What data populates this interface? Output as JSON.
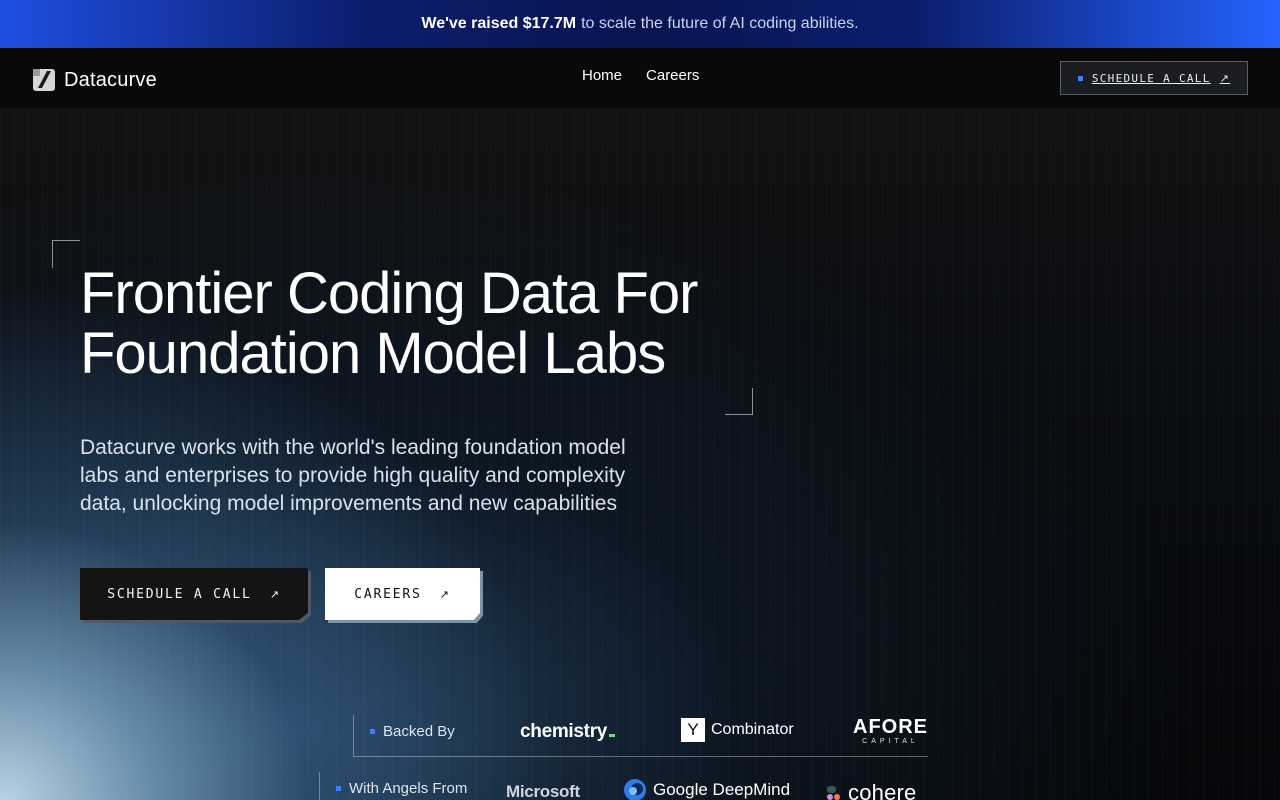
{
  "announcement": {
    "highlight": "We've raised $17.7M",
    "rest": "to scale the future of AI coding abilities."
  },
  "nav": {
    "brand": "Datacurve",
    "links": [
      "Home",
      "Careers"
    ],
    "cta": "SCHEDULE A CALL",
    "cta_arrow": "↗"
  },
  "hero": {
    "headline_line1": "Frontier Coding Data For",
    "headline_line2": "Foundation Model Labs",
    "subtext": "Datacurve works with the world's leading foundation model labs and enterprises to provide high quality and complexity data, unlocking model improvements and new capabilities",
    "primary_button": "SCHEDULE A CALL",
    "secondary_button": "CAREERS",
    "arrow": "↗"
  },
  "backers": {
    "label": "Backed By",
    "logos": {
      "chemistry": "chemistry",
      "yc_letter": "Y",
      "yc_text": "Combinator",
      "afore_main": "AFORE",
      "afore_sub": "CAPITAL"
    }
  },
  "angels": {
    "label": "With Angels From",
    "logos": {
      "microsoft": "Microsoft",
      "deepmind": "Google DeepMind",
      "cohere": "cohere"
    }
  },
  "colors": {
    "accent_blue": "#3b82f6",
    "banner_blue": "#2563ff"
  }
}
